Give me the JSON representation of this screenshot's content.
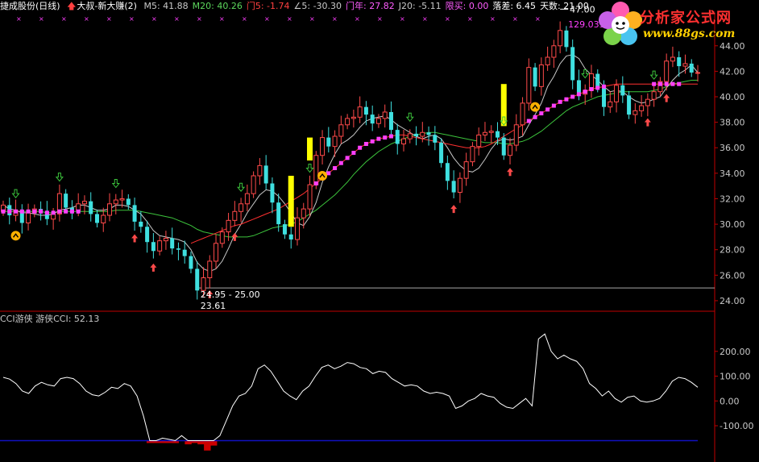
{
  "header": {
    "title": "捷成股份(日线)",
    "indicator_name": "大叔-新大赚(2)",
    "items": [
      {
        "label": "M5: 41.88",
        "color": "#c8c8c8"
      },
      {
        "label": "M20: 40.26",
        "color": "#5cd65c"
      },
      {
        "label": "门5: -1.74",
        "color": "#ff4040"
      },
      {
        "label": "∠5: -30.30",
        "color": "#c8c8c8"
      },
      {
        "label": "门年: 27.82",
        "color": "#ff5cff"
      },
      {
        "label": "J20: -5.11",
        "color": "#c8c8c8"
      },
      {
        "label": "限买: 0.00",
        "color": "#ff5cff"
      },
      {
        "label": "落差: 6.45",
        "color": "#ffffff"
      },
      {
        "label": "天数: 21.00",
        "color": "#ffffff"
      }
    ]
  },
  "logo": {
    "title": "分析家公式网",
    "url": "www.88gs.com"
  },
  "subchart": {
    "name": "CCI游侠",
    "value_label": "游侠CCI: 52.13"
  },
  "colors": {
    "up": "#ff4a4a",
    "down": "#3fe0e0",
    "ma_short": "#c8c8c8",
    "ma_long": "#3cc33c",
    "support": "#ff3030",
    "dots": "#ff40ff",
    "signal_bar": "#ffff00",
    "axis": "#c00000",
    "cci": "#ffffff",
    "cci_low": "#1010c0",
    "cci_fill": "#cc0000"
  },
  "chart_data": [
    {
      "type": "candlestick",
      "title": "",
      "yaxis_ticks": [
        24.0,
        26.0,
        28.0,
        30.0,
        32.0,
        34.0,
        36.0,
        38.0,
        40.0,
        42.0,
        44.0
      ],
      "ylim": [
        23.3,
        46.2
      ],
      "annotations": [
        {
          "text": "24.95 - 25.00",
          "value": 25.0
        },
        {
          "text": "23.61",
          "value": 23.61
        },
        {
          "text": "47.00",
          "value": 47.0
        },
        {
          "text": "129.033",
          "value": 45.7
        }
      ],
      "close": [
        31.5,
        30.7,
        31.1,
        30.1,
        30.9,
        31.2,
        31.0,
        30.4,
        30.8,
        32.4,
        31.3,
        31.1,
        31.6,
        31.8,
        30.8,
        30.1,
        30.7,
        31.6,
        31.9,
        32.0,
        31.5,
        30.2,
        29.8,
        28.6,
        27.9,
        28.7,
        28.9,
        28.1,
        28.0,
        27.5,
        26.5,
        24.8,
        25.8,
        27.1,
        28.5,
        29.4,
        30.3,
        31.0,
        31.6,
        32.4,
        33.8,
        34.6,
        33.2,
        31.7,
        30.0,
        29.2,
        28.8,
        30.5,
        31.2,
        33.1,
        35.4,
        36.8,
        36.1,
        36.9,
        37.8,
        38.3,
        38.4,
        39.2,
        38.6,
        37.9,
        38.3,
        38.8,
        37.4,
        36.3,
        36.7,
        37.1,
        36.9,
        37.2,
        37.0,
        36.4,
        34.8,
        33.4,
        32.5,
        33.6,
        34.9,
        36.1,
        37.0,
        37.2,
        37.3,
        36.8,
        35.4,
        36.2,
        37.8,
        39.5,
        42.3,
        40.8,
        42.5,
        43.1,
        44.0,
        45.2,
        43.9,
        41.3,
        40.2,
        40.5,
        41.8,
        40.7,
        39.2,
        39.6,
        40.9,
        40.1,
        38.6,
        38.9,
        39.3,
        39.8,
        40.4,
        41.2,
        42.8,
        43.1,
        42.4,
        42.6,
        41.9,
        41.9
      ],
      "open": [
        31.0,
        31.5,
        30.7,
        31.1,
        30.1,
        30.9,
        31.2,
        31.0,
        30.4,
        30.8,
        32.4,
        31.3,
        31.1,
        31.6,
        31.8,
        30.8,
        30.1,
        30.7,
        31.6,
        31.9,
        32.0,
        31.5,
        30.2,
        29.8,
        28.6,
        27.9,
        28.7,
        28.9,
        28.1,
        28.0,
        27.5,
        26.5,
        24.8,
        25.8,
        27.1,
        28.5,
        29.4,
        30.3,
        31.0,
        31.6,
        32.4,
        33.8,
        34.6,
        33.2,
        31.7,
        30.0,
        29.2,
        28.8,
        30.5,
        31.2,
        33.1,
        35.4,
        36.8,
        36.1,
        36.9,
        37.8,
        38.3,
        38.4,
        39.2,
        38.6,
        37.9,
        38.3,
        38.8,
        37.4,
        36.3,
        36.7,
        37.1,
        36.9,
        37.2,
        37.0,
        36.4,
        34.8,
        33.4,
        32.5,
        33.6,
        34.9,
        36.1,
        37.0,
        37.2,
        37.3,
        36.8,
        35.4,
        36.2,
        37.8,
        39.5,
        42.3,
        40.8,
        42.5,
        43.1,
        44.0,
        45.2,
        43.9,
        41.3,
        40.2,
        40.5,
        41.8,
        40.7,
        39.2,
        39.6,
        40.9,
        40.1,
        38.6,
        38.9,
        39.3,
        39.8,
        40.4,
        41.2,
        42.8,
        43.1,
        42.4,
        42.6,
        41.9
      ],
      "ma_short": [
        31.5,
        31.2,
        31.1,
        30.9,
        30.9,
        30.8,
        30.7,
        30.7,
        30.8,
        31.1,
        31.2,
        31.3,
        31.5,
        31.5,
        31.3,
        31.1,
        31.1,
        31.2,
        31.5,
        31.5,
        31.4,
        31.1,
        30.8,
        30.2,
        29.5,
        29.1,
        29.0,
        28.9,
        28.8,
        28.6,
        28.0,
        27.0,
        26.5,
        26.3,
        26.5,
        27.1,
        28.1,
        29.2,
        30.0,
        30.9,
        31.6,
        32.3,
        32.7,
        32.6,
        32.2,
        31.6,
        30.9,
        30.1,
        29.9,
        30.6,
        31.7,
        33.3,
        34.5,
        35.5,
        36.3,
        36.6,
        37.0,
        37.6,
        38.1,
        38.3,
        38.4,
        38.5,
        38.2,
        37.8,
        37.5,
        37.2,
        36.9,
        36.7,
        36.9,
        37.0,
        36.7,
        36.0,
        35.2,
        34.6,
        34.2,
        34.1,
        34.4,
        35.1,
        35.9,
        36.5,
        36.7,
        36.6,
        36.7,
        36.9,
        37.8,
        38.6,
        39.5,
        40.8,
        41.6,
        42.6,
        43.2,
        43.3,
        43.0,
        42.2,
        41.7,
        41.3,
        40.8,
        40.4,
        40.5,
        40.4,
        40.0,
        39.7,
        39.5,
        39.6,
        39.8,
        40.0,
        40.7,
        41.3,
        41.8,
        42.1,
        42.5,
        41.9
      ],
      "ma_long": [
        31.0,
        31.0,
        31.0,
        31.0,
        31.0,
        31.0,
        31.0,
        30.9,
        30.9,
        31.0,
        31.0,
        31.0,
        31.0,
        31.0,
        31.0,
        31.0,
        31.0,
        31.0,
        31.1,
        31.1,
        31.1,
        31.1,
        31.0,
        30.9,
        30.8,
        30.7,
        30.6,
        30.5,
        30.3,
        30.1,
        29.9,
        29.6,
        29.4,
        29.3,
        29.2,
        29.1,
        29.0,
        29.0,
        29.0,
        29.0,
        29.1,
        29.3,
        29.5,
        29.7,
        29.8,
        29.9,
        30.0,
        30.2,
        30.5,
        30.8,
        31.1,
        31.5,
        31.9,
        32.3,
        32.8,
        33.3,
        33.9,
        34.4,
        34.9,
        35.3,
        35.7,
        36.0,
        36.3,
        36.5,
        36.7,
        36.9,
        37.0,
        37.1,
        37.2,
        37.2,
        37.1,
        37.0,
        36.9,
        36.8,
        36.7,
        36.6,
        36.5,
        36.4,
        36.4,
        36.4,
        36.3,
        36.3,
        36.4,
        36.5,
        36.7,
        37.0,
        37.3,
        37.7,
        38.1,
        38.5,
        38.9,
        39.2,
        39.4,
        39.6,
        39.8,
        40.0,
        40.1,
        40.2,
        40.3,
        40.4,
        40.4,
        40.4,
        40.4,
        40.4,
        40.5,
        40.6,
        40.8,
        41.0,
        41.1,
        41.2,
        41.3,
        41.3
      ],
      "support": {
        "start": 30,
        "values": [
          28.5,
          28.7,
          28.9,
          29.1,
          29.3,
          29.5,
          29.7,
          29.9,
          30.0,
          30.2,
          30.4,
          30.6,
          30.8,
          31.0,
          31.2,
          31.5,
          31.8,
          32.1,
          32.4,
          32.8,
          33.2,
          33.6,
          34.0,
          34.4,
          34.8,
          35.2,
          35.6,
          36.0,
          36.3,
          36.5,
          36.7,
          36.8,
          36.9,
          37.0,
          37.0,
          36.9,
          36.8,
          36.7,
          36.6,
          36.5,
          36.4,
          36.3,
          36.2,
          36.1,
          36.0,
          36.0,
          36.0,
          36.1,
          36.3,
          36.6,
          36.9,
          37.2,
          37.5,
          37.8,
          38.1,
          38.4,
          38.7,
          39.0,
          39.3,
          39.6,
          39.8,
          40.0,
          40.2,
          40.4,
          40.6,
          40.7,
          40.8,
          40.9,
          41.0,
          41.0,
          41.0,
          41.0,
          41.0,
          41.0,
          41.0,
          41.0,
          41.0,
          41.0,
          41.0,
          41.0,
          41.0,
          41.0
        ]
      },
      "dots": [
        {
          "start": 0,
          "end": 12
        },
        {
          "start": 50,
          "end": 62
        },
        {
          "start": 84,
          "end": 96
        },
        {
          "start": 104,
          "end": 108
        }
      ],
      "signal_bars": [
        {
          "index": 46,
          "low": 29.8,
          "high": 33.8
        },
        {
          "index": 49,
          "low": 35.0,
          "high": 36.8
        },
        {
          "index": 80,
          "low": 37.7,
          "high": 41.0
        }
      ],
      "up_arrows": [
        21,
        24,
        33,
        37,
        72,
        81,
        103,
        106
      ],
      "down_arrows": [
        2,
        9,
        18,
        38,
        49,
        65,
        80,
        93,
        104
      ],
      "circles": [
        2,
        51,
        85
      ]
    },
    {
      "type": "line",
      "title": "",
      "yaxis_ticks": [
        200.0,
        100.0,
        0.0,
        -100.0
      ],
      "ylim": [
        -230,
        300
      ],
      "reference_level": -160,
      "values": [
        95,
        88,
        70,
        40,
        30,
        60,
        75,
        65,
        60,
        90,
        95,
        90,
        70,
        40,
        25,
        20,
        35,
        55,
        50,
        70,
        60,
        20,
        -60,
        -160,
        -165,
        -150,
        -155,
        -170,
        -140,
        -175,
        -165,
        -175,
        -200,
        -180,
        -140,
        -80,
        -20,
        20,
        30,
        60,
        130,
        145,
        120,
        80,
        40,
        20,
        5,
        40,
        60,
        100,
        135,
        145,
        130,
        140,
        155,
        150,
        135,
        130,
        110,
        120,
        115,
        90,
        75,
        60,
        65,
        60,
        40,
        30,
        35,
        30,
        20,
        -30,
        -20,
        0,
        10,
        30,
        20,
        15,
        -10,
        -25,
        -30,
        -10,
        10,
        -20,
        250,
        270,
        200,
        170,
        185,
        170,
        160,
        130,
        70,
        50,
        20,
        40,
        10,
        -5,
        15,
        20,
        0,
        -5,
        0,
        10,
        40,
        80,
        95,
        90,
        75,
        55
      ]
    }
  ]
}
